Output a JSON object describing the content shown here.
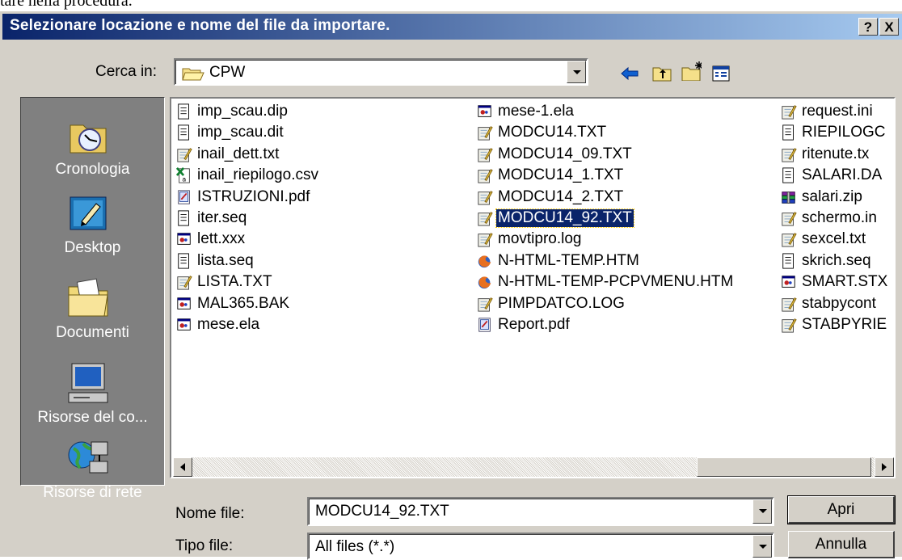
{
  "doc_text": "tare nella procedura.",
  "dialog": {
    "title": "Selezionare locazione e nome del file da importare.",
    "help_label": "?",
    "close_label": "X"
  },
  "look_in": {
    "label": "Cerca in:",
    "value": "CPW"
  },
  "toolbar_icons": [
    "back-arrow-icon",
    "up-folder-icon",
    "new-folder-icon",
    "view-menu-icon"
  ],
  "places": [
    {
      "label": "Cronologia",
      "icon": "history-icon"
    },
    {
      "label": "Desktop",
      "icon": "desktop-icon"
    },
    {
      "label": "Documenti",
      "icon": "documents-icon"
    },
    {
      "label": "Risorse del co...",
      "icon": "my-computer-icon"
    },
    {
      "label": "Risorse di rete",
      "icon": "network-icon"
    }
  ],
  "files": [
    [
      {
        "name": "imp_scau.dip",
        "icon": "text"
      },
      {
        "name": "imp_scau.dit",
        "icon": "text"
      },
      {
        "name": "inail_dett.txt",
        "icon": "notepad"
      },
      {
        "name": "inail_riepilogo.csv",
        "icon": "excel"
      },
      {
        "name": "ISTRUZIONI.pdf",
        "icon": "pdf"
      },
      {
        "name": "iter.seq",
        "icon": "text"
      },
      {
        "name": "lett.xxx",
        "icon": "app"
      },
      {
        "name": "lista.seq",
        "icon": "text"
      },
      {
        "name": "LISTA.TXT",
        "icon": "notepad"
      },
      {
        "name": "MAL365.BAK",
        "icon": "app"
      },
      {
        "name": "mese.ela",
        "icon": "app"
      }
    ],
    [
      {
        "name": "mese-1.ela",
        "icon": "app"
      },
      {
        "name": "MODCU14.TXT",
        "icon": "notepad"
      },
      {
        "name": "MODCU14_09.TXT",
        "icon": "notepad"
      },
      {
        "name": "MODCU14_1.TXT",
        "icon": "notepad"
      },
      {
        "name": "MODCU14_2.TXT",
        "icon": "notepad"
      },
      {
        "name": "MODCU14_92.TXT",
        "icon": "notepad",
        "selected": true
      },
      {
        "name": "movtipro.log",
        "icon": "notepad"
      },
      {
        "name": "N-HTML-TEMP.HTM",
        "icon": "firefox"
      },
      {
        "name": "N-HTML-TEMP-PCPVMENU.HTM",
        "icon": "firefox"
      },
      {
        "name": "PIMPDATCO.LOG",
        "icon": "notepad"
      },
      {
        "name": "Report.pdf",
        "icon": "pdf"
      }
    ],
    [
      {
        "name": "request.ini",
        "icon": "notepad"
      },
      {
        "name": "RIEPILOGC",
        "icon": "text"
      },
      {
        "name": "ritenute.tx",
        "icon": "notepad"
      },
      {
        "name": "SALARI.DA",
        "icon": "text"
      },
      {
        "name": "salari.zip",
        "icon": "zip"
      },
      {
        "name": "schermo.in",
        "icon": "notepad"
      },
      {
        "name": "sexcel.txt",
        "icon": "notepad"
      },
      {
        "name": "skrich.seq",
        "icon": "text"
      },
      {
        "name": "SMART.STX",
        "icon": "app"
      },
      {
        "name": "stabpycont",
        "icon": "notepad"
      },
      {
        "name": "STABPYRIE",
        "icon": "notepad"
      }
    ]
  ],
  "filename": {
    "label": "Nome file:",
    "value": "MODCU14_92.TXT"
  },
  "filetype": {
    "label": "Tipo file:",
    "value": "All files (*.*)"
  },
  "buttons": {
    "open": "Apri",
    "cancel": "Annulla"
  }
}
